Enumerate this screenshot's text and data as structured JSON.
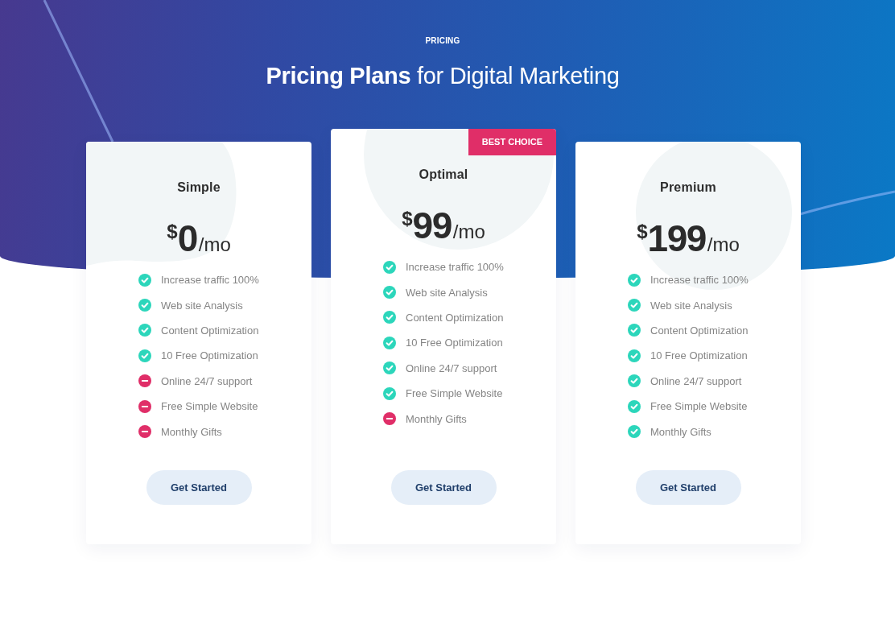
{
  "section": {
    "eyebrow": "PRICING",
    "heading": "**Pricing Plans** for Digital Marketing"
  },
  "plans": [
    {
      "name": "Simple",
      "featured": false,
      "currency": "$",
      "amount": "0",
      "period": "/mo",
      "features": [
        {
          "text": "Increase traffic 100%",
          "included": true
        },
        {
          "text": "Web site Analysis",
          "included": true
        },
        {
          "text": "Content Optimization",
          "included": true
        },
        {
          "text": "10 Free Optimization",
          "included": true
        },
        {
          "text": "Online 24/7 support",
          "included": false
        },
        {
          "text": "Free Simple Website",
          "included": false
        },
        {
          "text": "Monthly Gifts",
          "included": false
        }
      ],
      "button": "Get Started"
    },
    {
      "name": "Optimal",
      "featured": true,
      "badge": "BEST CHOICE",
      "currency": "$",
      "amount": "99",
      "period": "/mo",
      "features": [
        {
          "text": "Increase traffic 100%",
          "included": true
        },
        {
          "text": "Web site Analysis",
          "included": true
        },
        {
          "text": "Content Optimization",
          "included": true
        },
        {
          "text": "10 Free Optimization",
          "included": true
        },
        {
          "text": "Online 24/7 support",
          "included": true
        },
        {
          "text": "Free Simple Website",
          "included": true
        },
        {
          "text": "Monthly Gifts",
          "included": false
        }
      ],
      "button": "Get Started"
    },
    {
      "name": "Premium",
      "featured": false,
      "currency": "$",
      "amount": "199",
      "period": "/mo",
      "features": [
        {
          "text": "Increase traffic 100%",
          "included": true
        },
        {
          "text": "Web site Analysis",
          "included": true
        },
        {
          "text": "Content Optimization",
          "included": true
        },
        {
          "text": "10 Free Optimization",
          "included": true
        },
        {
          "text": "Online 24/7 support",
          "included": true
        },
        {
          "text": "Free Simple Website",
          "included": true
        },
        {
          "text": "Monthly Gifts",
          "included": true
        }
      ],
      "button": "Get Started"
    }
  ]
}
